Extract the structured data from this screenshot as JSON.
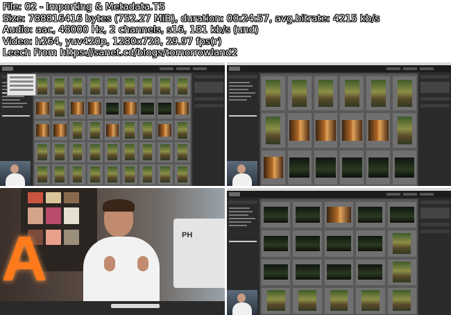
{
  "file_info": {
    "lines": [
      "File: 02 - Importing & Metadata.TS",
      "Size: 788816416 bytes (752.27 MiB), duration: 00:24:57, avg.bitrate: 4215 kb/s",
      "Audio: aac, 48000 Hz, 2 channels, s16, 181 kb/s (und)",
      "Video: h264, yuv420p, 1280x720, 29.97 fps(r)",
      "Leech From https://sanet.cd/blogs/tomorrowland2"
    ]
  },
  "frames": [
    {
      "name": "lightroom-grid-view",
      "dropdown_open": true
    },
    {
      "name": "lightroom-grid-view-large"
    },
    {
      "name": "presenter-studio"
    },
    {
      "name": "lightroom-grid-view-filtered"
    }
  ],
  "studio": {
    "monitor_text": "PH"
  }
}
